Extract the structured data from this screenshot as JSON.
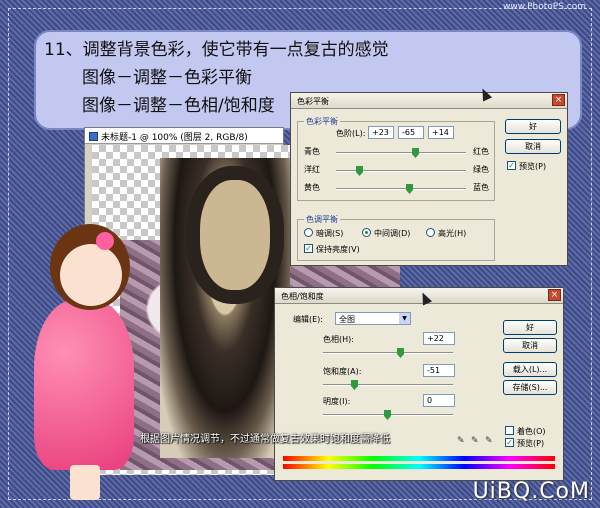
{
  "watermark_top": "www.PhotoPS.com",
  "brand": "UiBQ.CoM",
  "tutorial": {
    "step": "11、调整背景色彩，使它带有一点复古的感觉",
    "line1": "图像－调整－色彩平衡",
    "line2": "图像－调整－色相/饱和度"
  },
  "canvas_window": {
    "title": "未标题-1 @ 100% (图层 2, RGB/8)"
  },
  "color_balance": {
    "title": "色彩平衡",
    "group_title": "色彩平衡",
    "levels_label": "色阶(L):",
    "levels": [
      "+23",
      "-65",
      "+14"
    ],
    "rows": [
      {
        "left": "青色",
        "right": "红色",
        "value": 23
      },
      {
        "left": "洋红",
        "right": "绿色",
        "value": -65
      },
      {
        "left": "黄色",
        "right": "蓝色",
        "value": 14
      }
    ],
    "tone_group_title": "色调平衡",
    "tone_shadows": "暗调(S)",
    "tone_midtones": "中间调(D)",
    "tone_highlights": "高光(H)",
    "selected_tone": "中间调(D)",
    "preserve_luminosity": "保持亮度(V)",
    "preserve_checked": true,
    "ok": "好",
    "cancel": "取消",
    "preview": "预览(P)",
    "preview_checked": true
  },
  "hue_saturation": {
    "title": "色相/饱和度",
    "edit_label": "编辑(E):",
    "edit_value": "全图",
    "hue_label": "色相(H):",
    "hue_value": "+22",
    "hue": 22,
    "saturation_label": "饱和度(A):",
    "saturation_value": "-51",
    "saturation": -51,
    "lightness_label": "明度(I):",
    "lightness_value": "0",
    "lightness": 0,
    "ok": "好",
    "cancel": "取消",
    "load": "载入(L)...",
    "save": "存储(S)...",
    "colorize": "着色(O)",
    "colorize_checked": false,
    "preview": "预览(P)",
    "preview_checked": true
  },
  "caption": "根据图片情况调节，不过通常做复古效果时饱和度需降低",
  "colors": {
    "background": "#4d5a92",
    "panel": "#c3c8f0",
    "dress": "#e83d7c"
  }
}
